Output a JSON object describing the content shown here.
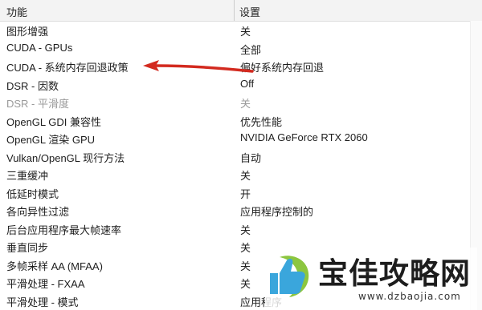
{
  "header": {
    "feature_label": "功能",
    "setting_label": "设置"
  },
  "rows": [
    {
      "feature": "图形增强",
      "setting": "关",
      "disabled": false
    },
    {
      "feature": "CUDA - GPUs",
      "setting": "全部",
      "disabled": false
    },
    {
      "feature": "CUDA - 系统内存回退政策",
      "setting": "偏好系统内存回退",
      "disabled": false
    },
    {
      "feature": "DSR - 因数",
      "setting": "Off",
      "disabled": false
    },
    {
      "feature": "DSR - 平滑度",
      "setting": "关",
      "disabled": true
    },
    {
      "feature": "OpenGL GDI 兼容性",
      "setting": "优先性能",
      "disabled": false
    },
    {
      "feature": "OpenGL 渲染 GPU",
      "setting": "NVIDIA GeForce RTX 2060",
      "disabled": false
    },
    {
      "feature": "Vulkan/OpenGL 现行方法",
      "setting": "自动",
      "disabled": false
    },
    {
      "feature": "三重缓冲",
      "setting": "关",
      "disabled": false
    },
    {
      "feature": "低延时模式",
      "setting": "开",
      "disabled": false
    },
    {
      "feature": "各向异性过滤",
      "setting": "应用程序控制的",
      "disabled": false
    },
    {
      "feature": "后台应用程序最大帧速率",
      "setting": "关",
      "disabled": false
    },
    {
      "feature": "垂直同步",
      "setting": "关",
      "disabled": false
    },
    {
      "feature": "多帧采样 AA (MFAA)",
      "setting": "关",
      "disabled": false
    },
    {
      "feature": "平滑处理 - FXAA",
      "setting": "关",
      "disabled": false
    },
    {
      "feature": "平滑处理 - 模式",
      "setting": "应用程序",
      "disabled": false
    }
  ],
  "watermark": {
    "brand": "宝佳攻略网",
    "site": "www.dzbaojia.com"
  },
  "colors": {
    "arrow": "#d32a1f",
    "logo_primary": "#3aa6dc",
    "logo_accent": "#8cc63f"
  }
}
